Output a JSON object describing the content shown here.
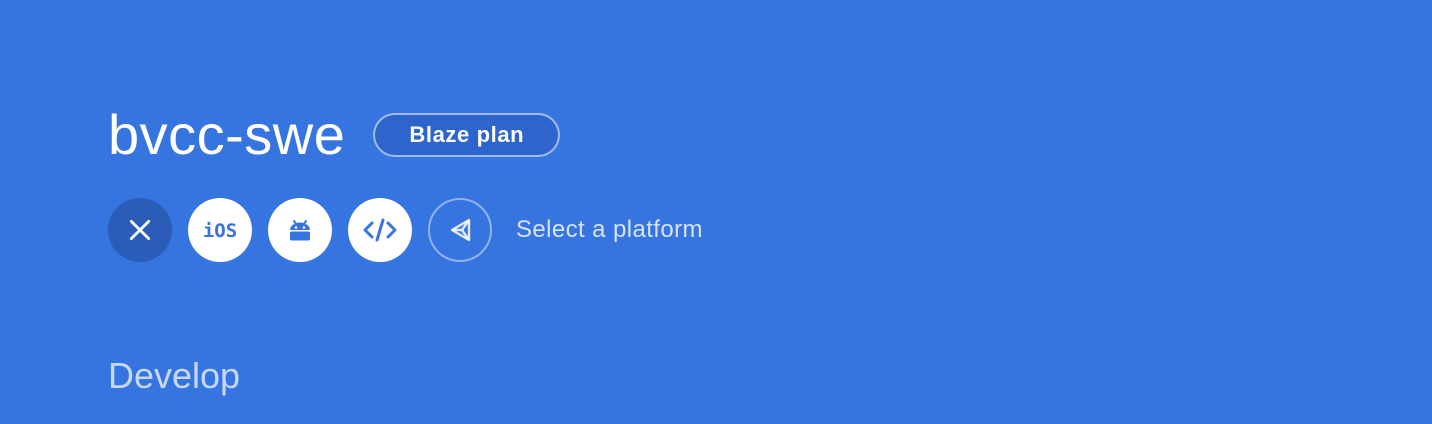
{
  "project": {
    "name": "bvcc-swe",
    "plan_label": "Blaze plan"
  },
  "platforms": {
    "buttons": [
      {
        "name": "close",
        "icon": "close-icon"
      },
      {
        "name": "ios",
        "icon": "ios-icon",
        "label": "iOS"
      },
      {
        "name": "android",
        "icon": "android-icon"
      },
      {
        "name": "web",
        "icon": "code-icon"
      },
      {
        "name": "unity",
        "icon": "unity-icon"
      }
    ],
    "prompt": "Select a platform"
  },
  "section": {
    "title": "Develop"
  },
  "colors": {
    "background": "#3674e0",
    "accent": "#2a5cb8",
    "text": "#ffffff"
  }
}
